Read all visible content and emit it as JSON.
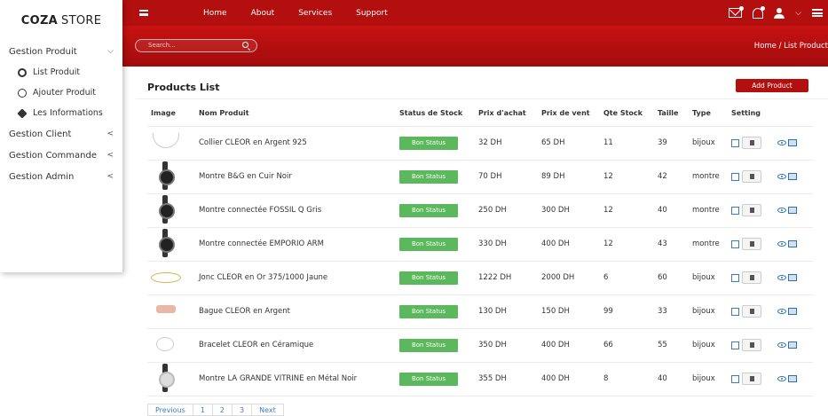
{
  "sidebar": {
    "brand_bold": "COZA",
    "brand_rest": "STORE",
    "groups": [
      {
        "label": "Gestion Produit",
        "chevron": "⌵"
      },
      {
        "label": "Gestion Client",
        "chevron": "<"
      },
      {
        "label": "Gestion Commande",
        "chevron": "<"
      },
      {
        "label": "Gestion Admin",
        "chevron": "<"
      }
    ],
    "produit_items": [
      {
        "label": "List Produit",
        "icon": "gear-icon"
      },
      {
        "label": "Ajouter Produit",
        "icon": "circle-icon"
      },
      {
        "label": "Les Informations",
        "icon": "cubes-icon"
      }
    ]
  },
  "topbar": {
    "links": [
      "Home",
      "About",
      "Services",
      "Support"
    ],
    "accent": "#b30f0f"
  },
  "band": {
    "search_placeholder": "Search...",
    "breadcrumb": "Home / List Product"
  },
  "products": {
    "title": "Products List",
    "add_label": "Add Product",
    "headers": [
      "Image",
      "Nom Produit",
      "Status de Stock",
      "Prix d'achat",
      "Prix de vent",
      "Qte Stock",
      "Taille",
      "Type",
      "Setting"
    ],
    "rows": [
      {
        "name": "Collier CLEOR en Argent 925",
        "status": "Bon Status",
        "achat": "32 DH",
        "vente": "65 DH",
        "qte": "11",
        "taille": "39",
        "type": "bijoux",
        "img": "necklace"
      },
      {
        "name": "Montre B&G en Cuir Noir",
        "status": "Bon Status",
        "achat": "70 DH",
        "vente": "89 DH",
        "qte": "12",
        "taille": "42",
        "type": "montre",
        "img": "watch"
      },
      {
        "name": "Montre connectée FOSSIL Q Gris",
        "status": "Bon Status",
        "achat": "250 DH",
        "vente": "300 DH",
        "qte": "12",
        "taille": "40",
        "type": "montre",
        "img": "watch"
      },
      {
        "name": "Montre connectée EMPORIO ARM",
        "status": "Bon Status",
        "achat": "330 DH",
        "vente": "400 DH",
        "qte": "12",
        "taille": "43",
        "type": "montre",
        "img": "watch"
      },
      {
        "name": "Jonc CLEOR en Or 375/1000 Jaune",
        "status": "Bon Status",
        "achat": "1222 DH",
        "vente": "2000 DH",
        "qte": "6",
        "taille": "60",
        "type": "bijoux",
        "img": "ring"
      },
      {
        "name": "Bague CLEOR en Argent",
        "status": "Bon Status",
        "achat": "130 DH",
        "vente": "150 DH",
        "qte": "99",
        "taille": "33",
        "type": "bijoux",
        "img": "bague"
      },
      {
        "name": "Bracelet CLEOR en Céramique",
        "status": "Bon Status",
        "achat": "350 DH",
        "vente": "400 DH",
        "qte": "66",
        "taille": "55",
        "type": "bijoux",
        "img": "bracelet"
      },
      {
        "name": "Montre LA GRANDE VITRINE en Métal Noir",
        "status": "Bon Status",
        "achat": "355 DH",
        "vente": "400 DH",
        "qte": "8",
        "taille": "40",
        "type": "bijoux",
        "img": "watch silver"
      }
    ]
  },
  "pager": [
    "Previous",
    "1",
    "2",
    "3",
    "Next"
  ]
}
